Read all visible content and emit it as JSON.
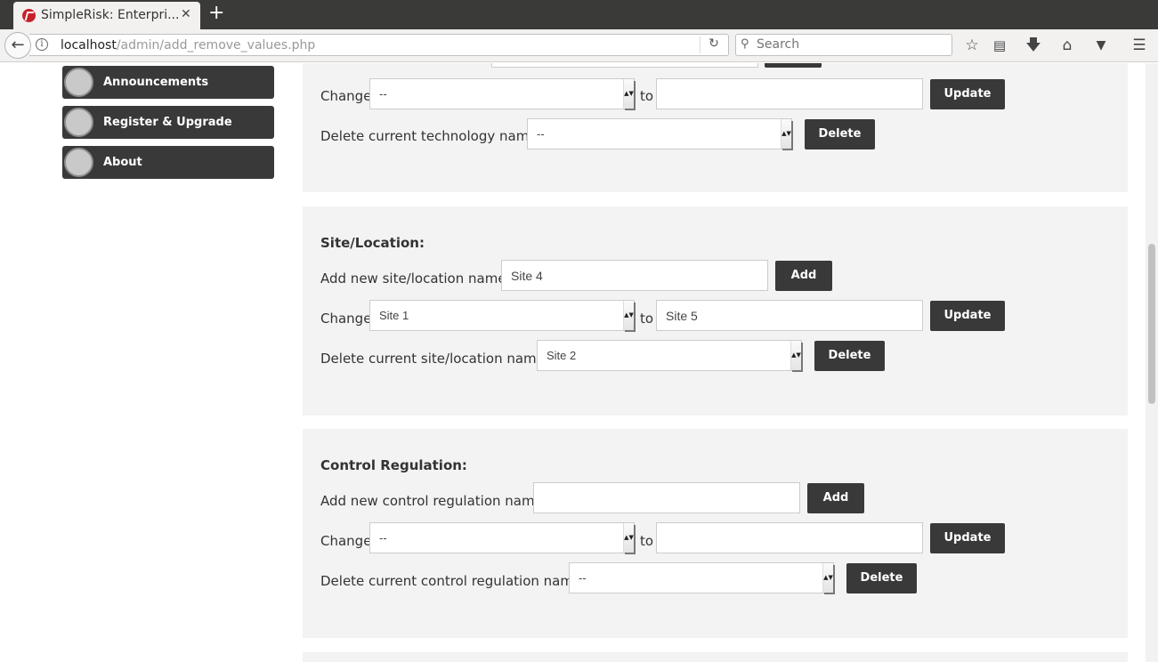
{
  "browser": {
    "tab_title": "SimpleRisk: Enterpri...",
    "tab_close": "✕",
    "new_tab": "+",
    "back": "←",
    "info": "i",
    "url_host": "localhost",
    "url_path": "/admin/add_remove_values.php",
    "reload": "↻",
    "search_placeholder": "Search",
    "toolbar_icons": [
      "star-icon",
      "reading-list-icon",
      "download-icon",
      "home-icon",
      "pocket-icon",
      "menu-icon"
    ]
  },
  "sidebar": {
    "items": [
      {
        "label": "Announcements"
      },
      {
        "label": "Register & Upgrade"
      },
      {
        "label": "About"
      }
    ]
  },
  "technology": {
    "change_label": "Change",
    "change_select": "--",
    "to_label": "to",
    "change_to_value": "",
    "update_label": "Update",
    "delete_label": "Delete current technology named",
    "delete_select": "--",
    "delete_button": "Delete"
  },
  "site_location": {
    "title": "Site/Location:",
    "add_label": "Add new site/location named",
    "add_value": "Site 4",
    "add_button": "Add",
    "change_label": "Change",
    "change_select": "Site 1",
    "to_label": "to",
    "change_to_value": "Site 5",
    "update_label": "Update",
    "delete_label": "Delete current site/location named",
    "delete_select": "Site 2",
    "delete_button": "Delete"
  },
  "control_regulation": {
    "title": "Control Regulation:",
    "add_label": "Add new control regulation named",
    "add_value": "",
    "add_button": "Add",
    "change_label": "Change",
    "change_select": "--",
    "to_label": "to",
    "change_to_value": "",
    "update_label": "Update",
    "delete_label": "Delete current control regulation named",
    "delete_select": "--",
    "delete_button": "Delete"
  }
}
